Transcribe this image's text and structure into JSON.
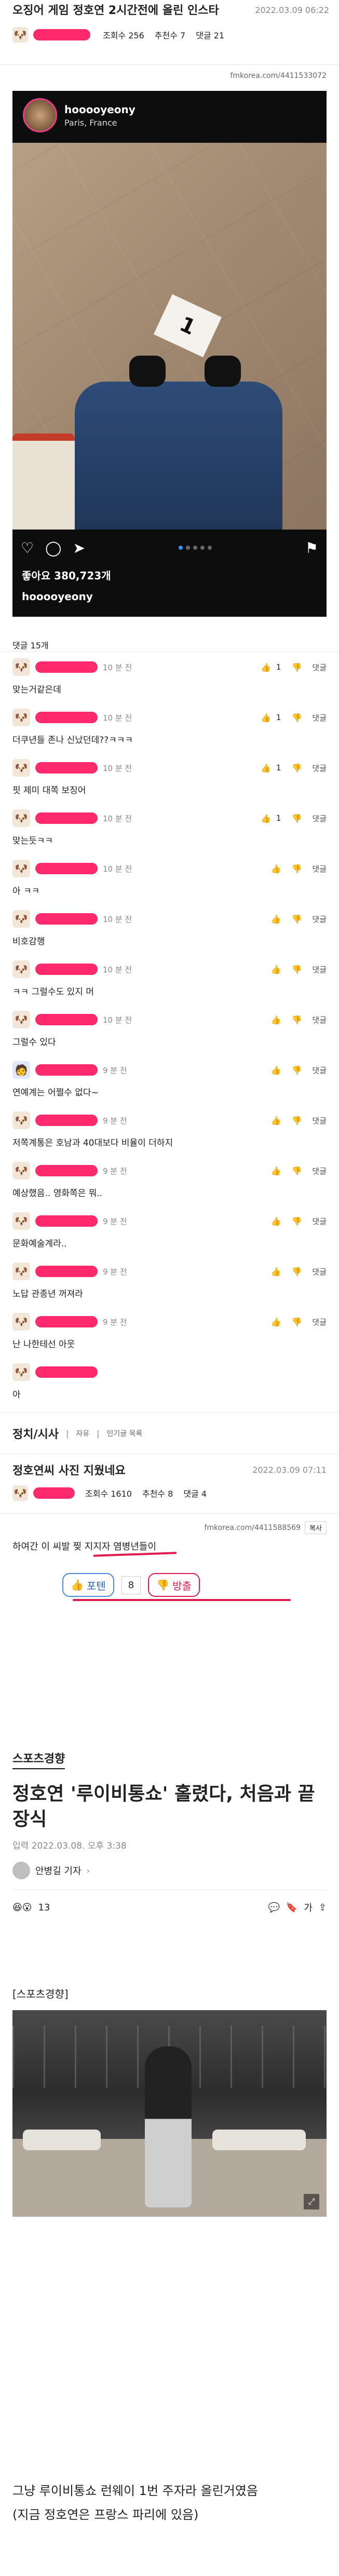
{
  "post": {
    "title": "오징어 게임 정호연 2시간전에 올린 인스타",
    "datetime": "2022.03.09 06:22",
    "views_label": "조회수 256",
    "recommend_label": "추천수 7",
    "comments_label": "댓글 21",
    "source_url_top": "fmkorea.com/4411533072",
    "comment_count_label": "댓글 15개"
  },
  "instagram": {
    "username": "hooooyeony",
    "location": "Paris, France",
    "likes_label": "좋아요 380,723개",
    "caption_username": "hooooyeony"
  },
  "comments": [
    {
      "time": "10 분 전",
      "text": "맞는거같은데",
      "like_label": "1"
    },
    {
      "time": "10 분 전",
      "text": "더쿠년들 존나 신났던데??ㅋㅋㅋ",
      "like_label": "1"
    },
    {
      "time": "10 분 전",
      "text": "핏 제미 대쪽 보징어",
      "like_label": "1"
    },
    {
      "time": "10 분 전",
      "text": "맞는듯ㅋㅋ",
      "like_label": "1"
    },
    {
      "time": "10 분 전",
      "text": "아 ㅋㅋ",
      "like_label": ""
    },
    {
      "time": "10 분 전",
      "text": "비호감행",
      "like_label": ""
    },
    {
      "time": "10 분 전",
      "text": "ㅋㅋ 그럴수도 있지 머",
      "like_label": ""
    },
    {
      "time": "10 분 전",
      "text": "그럴수 있다",
      "like_label": ""
    },
    {
      "time": "9 분 전",
      "text": "연예계는 어쩔수 없다~",
      "like_label": ""
    },
    {
      "time": "9 분 전",
      "text": "저쪽계통은 호남과 40대보다 비율이 더하지",
      "like_label": ""
    },
    {
      "time": "9 분 전",
      "text": "예상했음.. 영화쪽은 뭐..",
      "like_label": ""
    },
    {
      "time": "9 분 전",
      "text": "문화예술계라..",
      "like_label": ""
    },
    {
      "time": "9 분 전",
      "text": "노답 관종년 꺼져라",
      "like_label": ""
    },
    {
      "time": "9 분 전",
      "text": "난 나한테선 아웃",
      "like_label": ""
    },
    {
      "time": "",
      "text": "아",
      "like_label": ""
    }
  ],
  "board": {
    "category": "정치/시사",
    "tabs": [
      "자유",
      "인기글 목록"
    ]
  },
  "post2": {
    "title": "정호연씨 사진 지웠네요",
    "datetime": "2022.03.09 07:11",
    "views_label": "조회수 1610",
    "recommend_label": "추천수 8",
    "comments_label": "댓글 4",
    "source_url": "fmkorea.com/4411588569",
    "copy_label": "복사",
    "body": "하여간 이 씨발 찢 지지자 염병년들이",
    "vote_up_label": "포텐",
    "vote_count": "8",
    "vote_down_label": "방출"
  },
  "article": {
    "publisher": "스포츠경향",
    "headline": "정호연 '루이비통쇼' 홀렸다, 처음과 끝 장식",
    "date_label": "입력 2022.03.08. 오후 3:38",
    "reporter": "안병길 기자",
    "reaction_count": "13",
    "photo_caption_tag": "[스포츠경향]",
    "body_line1": "그냥 루이비통쇼 런웨이 1번 주자라 올린거였음",
    "body_line2": "(지금 정호연은 프랑스 파리에 있음)"
  },
  "colors": {
    "accent": "#ff2a6d",
    "vote_border": "#e01a4f",
    "instagram_dark": "#0d0d0d"
  }
}
